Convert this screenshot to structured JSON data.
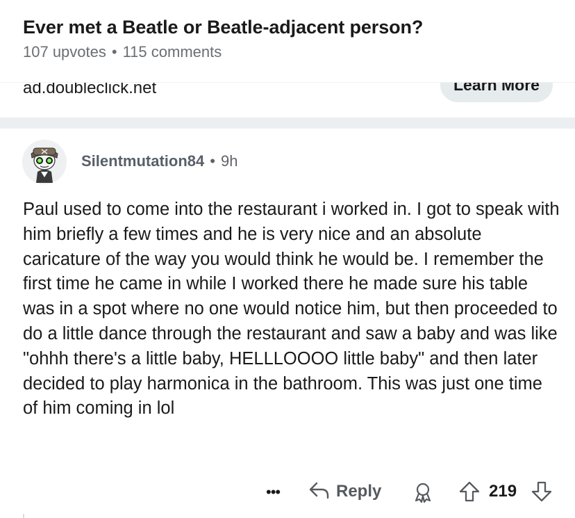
{
  "post": {
    "title": "Ever met a Beatle or Beatle-adjacent person?",
    "upvotes": "107 upvotes",
    "separator": "•",
    "comments": "115 comments"
  },
  "ad": {
    "domain": "ad.doubleclick.net",
    "cta": "Learn More"
  },
  "comment": {
    "author": "Silentmutation84",
    "separator": "•",
    "age": "9h",
    "body": "Paul used to come into the restaurant i worked in. I got to speak with him briefly a few times and he is very nice and an absolute caricature of the way you would think he would be. I remember the first time he came in while I worked there he made sure his table was in a spot where no one would notice him, but then proceeded to do a little dance through the restaurant and saw a baby and was like \"ohhh there's a little baby, HELLLOOOO little baby\" and then later decided to play harmonica in the bathroom. This was just one time of him coming in lol",
    "actions": {
      "more": "•••",
      "reply": "Reply",
      "score": "219"
    },
    "icons": {
      "avatar": "avatar-icon",
      "more": "more-options-icon",
      "reply": "reply-arrow-icon",
      "award": "award-icon",
      "upvote": "upvote-arrow-icon",
      "downvote": "downvote-arrow-icon"
    }
  },
  "colors": {
    "meta_text": "#6a6e72",
    "author_text": "#576069",
    "button_bg": "#e6ebee",
    "divider": "#eceff1",
    "avatar_eyes": "#7dff5a"
  }
}
